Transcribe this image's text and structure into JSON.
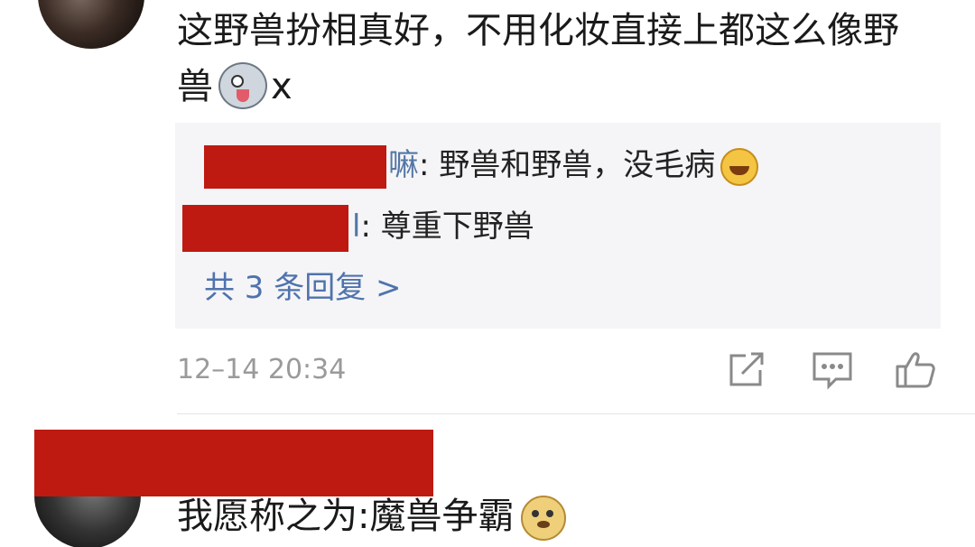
{
  "comment_1": {
    "line1": "这野兽扮相真好，不用化妆直接上都这么像野",
    "line2_text": "兽",
    "line2_suffix": "x",
    "emoji": "husky-emoji",
    "replies": [
      {
        "name_tail": "嘛",
        "text": ": 野兽和野兽，没毛病",
        "emoji": "laugh-cry-emoji"
      },
      {
        "name_tail": "l",
        "text": ": 尊重下野兽"
      }
    ],
    "more_replies": "共 3 条回复 >",
    "timestamp": "12–14 20:34",
    "actions": [
      "share-icon",
      "comment-icon",
      "like-icon"
    ]
  },
  "comment_2": {
    "line1": "我愿称之为:魔兽争霸",
    "emoji": "doge-emoji"
  },
  "colors": {
    "redaction": "#be1a12",
    "link": "#4f73ad",
    "reply_bg": "#f5f5f7",
    "muted": "#9a9a9a"
  }
}
